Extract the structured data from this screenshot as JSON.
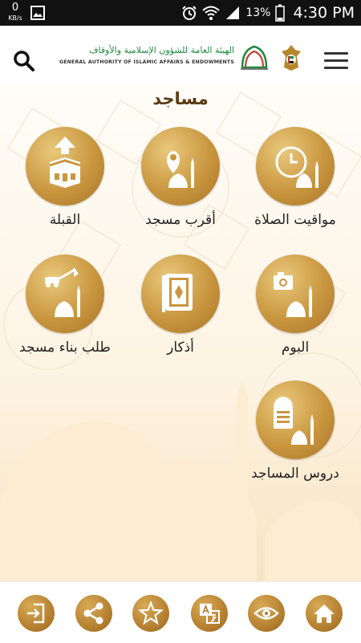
{
  "status_bar": {
    "net_speed": "0",
    "net_unit": "KB/s",
    "battery_percent": "13%",
    "time": "4:30 PM"
  },
  "header": {
    "org_name_ar": "الهيئة العامة للشؤون الإسلامية والأوقاف",
    "org_name_en": "GENERAL AUTHORITY OF ISLAMIC AFFAIRS & ENDOWMENTS"
  },
  "page": {
    "title": "مساجد"
  },
  "tiles": {
    "prayer_times": "مواقيت الصلاة",
    "nearest_mosque": "أقرب مسجد",
    "qibla": "القبلة",
    "album": "البوم",
    "azkar": "أذكار",
    "build_mosque": "طلب بناء مسجد",
    "mosque_lessons": "دروس المساجد"
  },
  "bottom_bar": {
    "icons": [
      "exit-icon",
      "share-icon",
      "star-icon",
      "translate-icon",
      "eye-icon",
      "home-icon"
    ]
  },
  "colors": {
    "gold": "#c9963f",
    "title_brown": "#5a3a12",
    "logo_green": "#1f8a3f"
  }
}
